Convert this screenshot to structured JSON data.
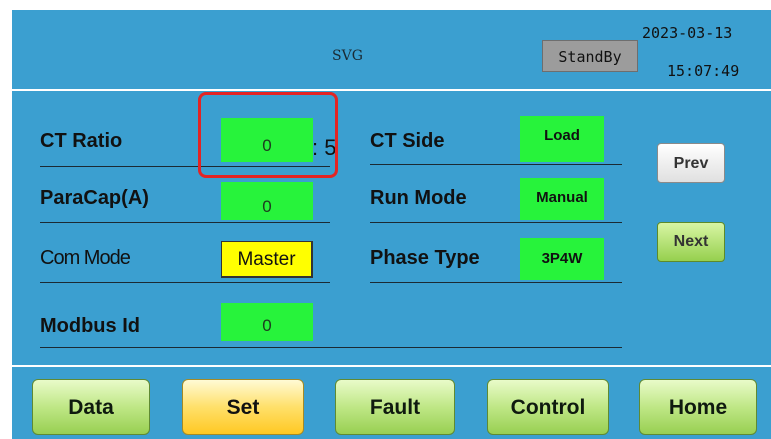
{
  "header": {
    "title": "SVG",
    "status": "StandBy",
    "date": "2023-03-13",
    "time": "15:07:49"
  },
  "settings": {
    "ct_ratio": {
      "label": "CT Ratio",
      "value": "0",
      "suffix": ": 5"
    },
    "para_cap": {
      "label": "ParaCap(A)",
      "value": "0"
    },
    "com_mode": {
      "label": "Com Mode",
      "value": "Master"
    },
    "modbus_id": {
      "label": "Modbus Id",
      "value": "0"
    },
    "ct_side": {
      "label": "CT Side",
      "value": "Load"
    },
    "run_mode": {
      "label": "Run Mode",
      "value": "Manual"
    },
    "phase_type": {
      "label": "Phase Type",
      "value": "3P4W"
    }
  },
  "side_buttons": {
    "prev": "Prev",
    "next": "Next"
  },
  "nav": {
    "data": "Data",
    "set": "Set",
    "fault": "Fault",
    "control": "Control",
    "home": "Home"
  },
  "colors": {
    "background": "#3b9fd0",
    "value_box": "#27f33b",
    "com_mode_box": "#ffff00",
    "active_nav": "#ffd43b",
    "nav_button": "#b7e07a",
    "highlight": "#e32424"
  }
}
